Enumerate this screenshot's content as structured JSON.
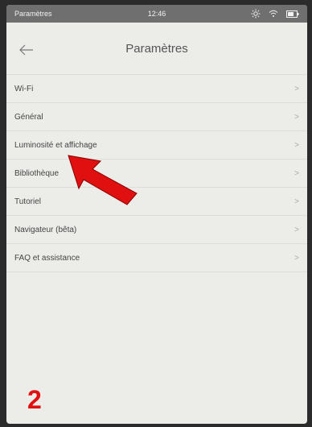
{
  "status_bar": {
    "title": "Paramètres",
    "time": "12:46",
    "icons": [
      "brightness-icon",
      "wifi-icon",
      "battery-icon"
    ]
  },
  "header": {
    "back_icon": "arrow-left-icon",
    "title": "Paramètres"
  },
  "menu": {
    "items": [
      {
        "label": "Wi-Fi"
      },
      {
        "label": "Général"
      },
      {
        "label": "Luminosité et affichage"
      },
      {
        "label": "Bibliothèque"
      },
      {
        "label": "Tutoriel"
      },
      {
        "label": "Navigateur (bêta)"
      },
      {
        "label": "FAQ et assistance"
      }
    ],
    "chevron": ">"
  },
  "annotation": {
    "step_number": "2",
    "arrow_color": "#e01010",
    "highlighted_item": "Bibliothèque"
  }
}
